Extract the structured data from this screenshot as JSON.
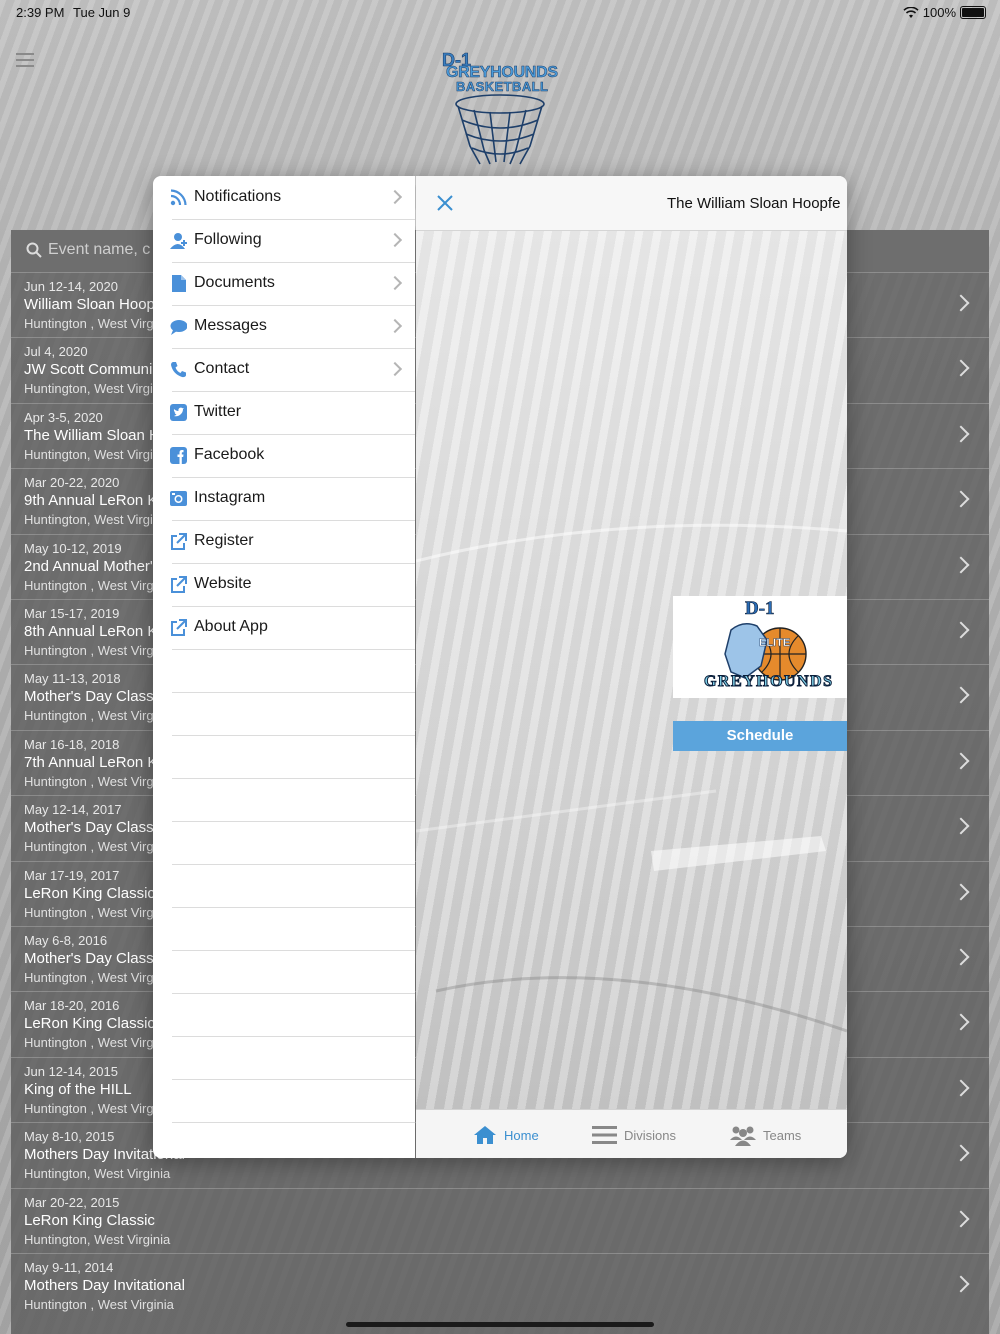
{
  "status": {
    "time": "2:39 PM",
    "date": "Tue Jun 9",
    "battery": "100%"
  },
  "search": {
    "placeholder": "Event name, c"
  },
  "events": [
    {
      "date": "Jun 12-14, 2020",
      "name": "William Sloan Hoop",
      "location": "Huntington , West Virgi"
    },
    {
      "date": "Jul 4, 2020",
      "name": "JW Scott Communi",
      "location": "Huntington, West Virgi"
    },
    {
      "date": "Apr 3-5, 2020",
      "name": "The William Sloan H",
      "location": "Huntington, West Virgi"
    },
    {
      "date": "Mar 20-22, 2020",
      "name": "9th Annual LeRon K",
      "location": "Huntington, West Virgi"
    },
    {
      "date": "May 10-12, 2019",
      "name": "2nd Annual Mother'",
      "location": "Huntington , West Virgi"
    },
    {
      "date": "Mar 15-17, 2019",
      "name": "8th Annual LeRon K",
      "location": "Huntington , West Virgi"
    },
    {
      "date": "May 11-13, 2018",
      "name": "Mother's Day Class",
      "location": "Huntington , West Virgi"
    },
    {
      "date": "Mar 16-18, 2018",
      "name": "7th Annual LeRon K",
      "location": "Huntington , West Virgi"
    },
    {
      "date": "May 12-14, 2017",
      "name": "Mother's Day Class",
      "location": "Huntington , West Virgi"
    },
    {
      "date": "Mar 17-19, 2017",
      "name": " LeRon King Classic",
      "location": "Huntington , West Virgi"
    },
    {
      "date": "May 6-8, 2016",
      "name": "Mother's Day Class",
      "location": "Huntington , West Virgi"
    },
    {
      "date": "Mar 18-20, 2016",
      "name": " LeRon King Classic",
      "location": "Huntington , West Virgi"
    },
    {
      "date": "Jun 12-14, 2015",
      "name": "King of the HILL",
      "location": "Huntington , West Virgi"
    },
    {
      "date": "May 8-10, 2015",
      "name": "Mothers Day Invitational",
      "location": "Huntington, West Virginia"
    },
    {
      "date": "Mar 20-22, 2015",
      "name": " LeRon King Classic",
      "location": "Huntington, West Virginia"
    },
    {
      "date": "May 9-11, 2014",
      "name": "Mothers Day Invitational",
      "location": "Huntington , West Virginia"
    }
  ],
  "menu": [
    {
      "label": "Notifications",
      "icon": "rss-icon",
      "arrow": true
    },
    {
      "label": "Following",
      "icon": "add-user-icon",
      "arrow": true
    },
    {
      "label": "Documents",
      "icon": "document-icon",
      "arrow": true
    },
    {
      "label": "Messages",
      "icon": "chat-bubble-icon",
      "arrow": true
    },
    {
      "label": "Contact",
      "icon": "phone-icon",
      "arrow": true
    },
    {
      "label": "Twitter",
      "icon": "twitter-icon",
      "arrow": false
    },
    {
      "label": "Facebook",
      "icon": "facebook-icon",
      "arrow": false
    },
    {
      "label": "Instagram",
      "icon": "instagram-icon",
      "arrow": false
    },
    {
      "label": "Register",
      "icon": "external-link-icon",
      "arrow": false
    },
    {
      "label": "Website",
      "icon": "external-link-icon",
      "arrow": false
    },
    {
      "label": "About App",
      "icon": "external-link-icon",
      "arrow": false
    }
  ],
  "detail": {
    "title": "The William Sloan Hoopfe",
    "schedule_label": "Schedule",
    "team_logo": {
      "line1": "D-1",
      "line2": "ELITE",
      "line3": "GREYHOUNDS"
    }
  },
  "header_logo": {
    "line1": "D-1",
    "line2": "GREYHOUNDS",
    "line3": "BASKETBALL"
  },
  "tabs": [
    {
      "label": "Home",
      "icon": "home-icon",
      "active": true
    },
    {
      "label": "Divisions",
      "icon": "list-icon",
      "active": false
    },
    {
      "label": "Teams",
      "icon": "people-icon",
      "active": false
    }
  ],
  "colors": {
    "accent": "#5ba4dc",
    "icon_blue": "#4a90d9",
    "tab_active": "#3b8fd0"
  }
}
